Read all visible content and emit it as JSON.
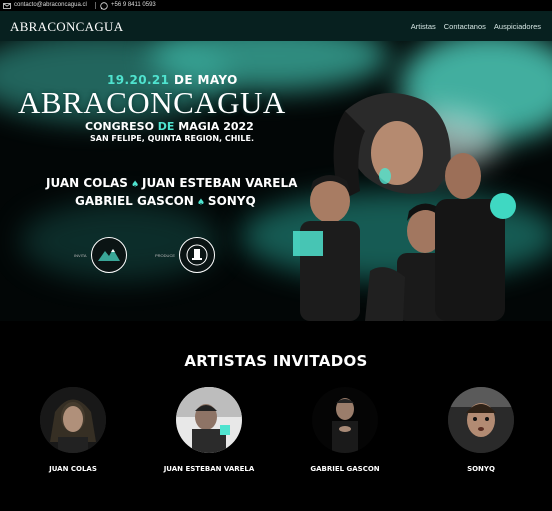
{
  "topbar": {
    "email": "contacto@abraconcagua.cl",
    "phone": "+56 9 8411 0593"
  },
  "nav": {
    "logo": "ABRACONCAGUA",
    "links": [
      "Artistas",
      "Contactanos",
      "Auspiciadores"
    ]
  },
  "hero": {
    "date_numbers": "19.20.21",
    "date_month": "DE MAYO",
    "title": "ABRACONCAGUA",
    "subtitle_a": "CONGRESO",
    "subtitle_b": "DE",
    "subtitle_c": "MAGIA 2022",
    "location": "SAN FELIPE, QUINTA REGION, CHILE.",
    "artists_line1_a": "JUAN COLAS",
    "artists_line1_b": "JUAN ESTEBAN VARELA",
    "artists_line2_a": "GABRIEL GASCON",
    "artists_line2_b": "SONYQ",
    "badge1_label": "INVITA",
    "badge2_label": "PRODUCE"
  },
  "section": {
    "title": "ARTISTAS INVITADOS"
  },
  "artists": [
    {
      "name": "JUAN COLAS"
    },
    {
      "name": "JUAN ESTEBAN VARELA"
    },
    {
      "name": "GABRIEL GASCON"
    },
    {
      "name": "SONYQ"
    }
  ],
  "colors": {
    "accent": "#4fe3cf",
    "nav_bg": "#07201f",
    "background": "#000000"
  }
}
